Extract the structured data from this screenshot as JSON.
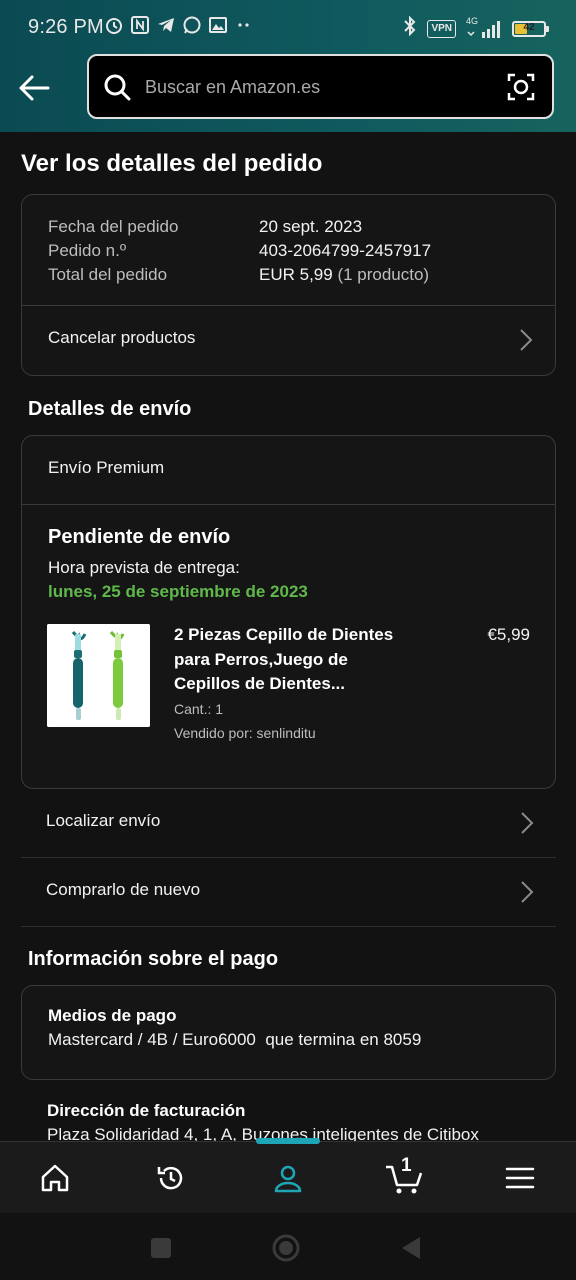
{
  "status_bar": {
    "time": "9:26 PM",
    "vpn": "VPN",
    "network": "4G",
    "battery": "42"
  },
  "search": {
    "placeholder": "Buscar en Amazon.es"
  },
  "page": {
    "title": "Ver los detalles del pedido"
  },
  "order_summary": {
    "date_label": "Fecha del pedido",
    "date_value": "20 sept. 2023",
    "number_label": "Pedido n.º",
    "number_value": "403-2064799-2457917",
    "total_label": "Total del pedido",
    "total_value": "EUR 5,99",
    "total_count": "(1 producto)",
    "cancel_label": "Cancelar productos"
  },
  "shipping": {
    "section_title": "Detalles de envío",
    "type": "Envío Premium",
    "status": "Pendiente de envío",
    "eta_label": "Hora prevista de entrega:",
    "eta_date": "lunes, 25 de septiembre de 2023",
    "product": {
      "title_line1": "2 Piezas Cepillo de Dientes",
      "title_line2": "para Perros,Juego de",
      "title_line3": "Cepillos de Dientes...",
      "price": "€5,99",
      "quantity": "Cant.: 1",
      "seller": "Vendido por: senlinditu"
    },
    "track_label": "Localizar envío",
    "buy_again_label": "Comprarlo de nuevo"
  },
  "payment": {
    "section_title": "Información sobre el pago",
    "methods_title": "Medios de pago",
    "methods_value": "Mastercard / 4B / Euro6000  que termina en 8059",
    "billing_title": "Dirección de facturación",
    "billing_value": "Plaza Solidaridad 4, 1, A, Buzones inteligentes de Citibox"
  },
  "bottom_nav": {
    "cart_count": "1"
  },
  "colors": {
    "header_teal": "#0f5a5e",
    "accent_green": "#5fb94a",
    "active_tab": "#1ea6b6"
  }
}
